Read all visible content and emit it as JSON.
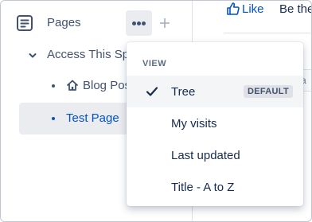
{
  "sidebar": {
    "pages_label": "Pages",
    "tree": {
      "space_label": "Access This Spa",
      "blog_label": "Blog Pos",
      "page_label": "Test Page"
    }
  },
  "content": {
    "like_label": "Like",
    "like_info": "Be the",
    "peek_text": "a"
  },
  "view_menu": {
    "header": "VIEW",
    "items": [
      {
        "label": "Tree",
        "badge": "DEFAULT",
        "selected": true
      },
      {
        "label": "My visits"
      },
      {
        "label": "Last updated"
      },
      {
        "label": "Title - A to Z"
      }
    ]
  },
  "colors": {
    "link": "#0052cc",
    "text": "#172b4d",
    "muted": "#42526e",
    "selected_bg": "#ebecf0"
  },
  "icons": {
    "pages": "document-lines-icon",
    "more": "more-horizontal-icon",
    "add": "plus-icon",
    "expand": "chevron-down-icon",
    "blog": "home-icon",
    "like": "thumbs-up-icon",
    "selected": "check-icon"
  }
}
